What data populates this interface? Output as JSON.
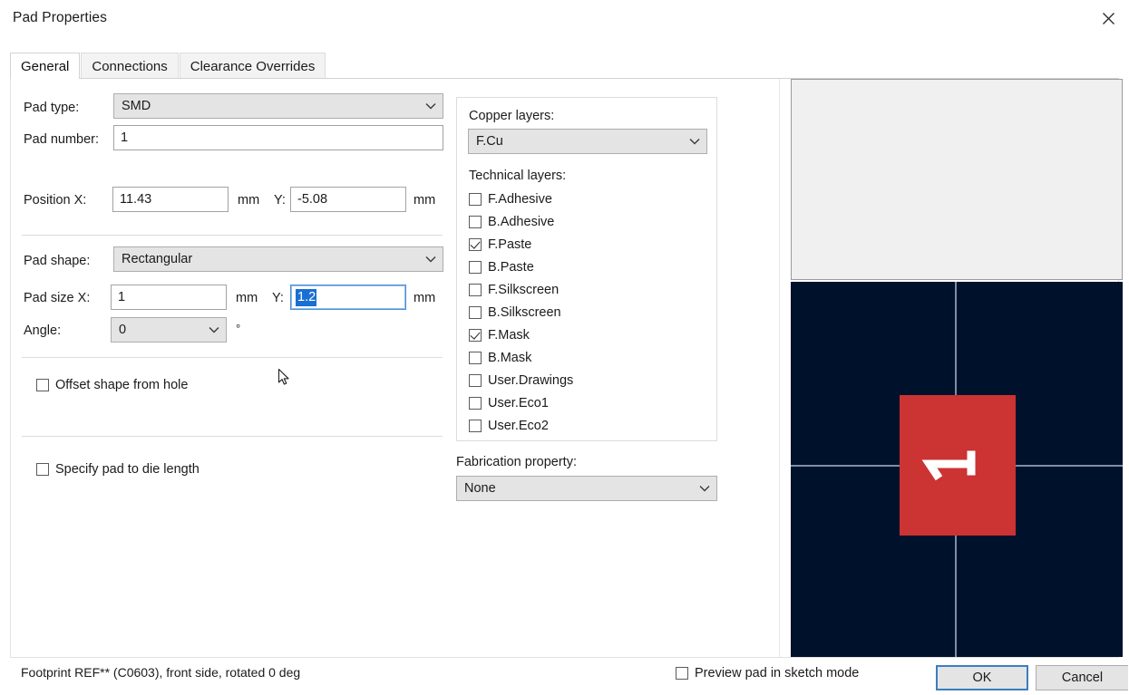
{
  "window": {
    "title": "Pad Properties",
    "close_icon": "close-icon"
  },
  "tabs": [
    {
      "label": "General",
      "active": true
    },
    {
      "label": "Connections",
      "active": false
    },
    {
      "label": "Clearance Overrides",
      "active": false
    }
  ],
  "general": {
    "pad_type": {
      "label": "Pad type:",
      "value": "SMD"
    },
    "pad_number": {
      "label": "Pad number:",
      "value": "1"
    },
    "position": {
      "x_label": "Position X:",
      "x_value": "11.43",
      "x_unit": "mm",
      "y_label": "Y:",
      "y_value": "-5.08",
      "y_unit": "mm"
    },
    "pad_shape": {
      "label": "Pad shape:",
      "value": "Rectangular"
    },
    "pad_size": {
      "x_label": "Pad size X:",
      "x_value": "1",
      "x_unit": "mm",
      "y_label": "Y:",
      "y_value": "1.2",
      "y_unit": "mm",
      "y_selected": true
    },
    "angle": {
      "label": "Angle:",
      "value": "0",
      "unit": "°"
    },
    "offset_shape": {
      "label": "Offset shape from hole",
      "checked": false
    },
    "die_length": {
      "label": "Specify pad to die length",
      "checked": false
    }
  },
  "layers": {
    "copper_label": "Copper layers:",
    "copper_value": "F.Cu",
    "technical_label": "Technical layers:",
    "technical_items": [
      {
        "label": "F.Adhesive",
        "checked": false
      },
      {
        "label": "B.Adhesive",
        "checked": false
      },
      {
        "label": "F.Paste",
        "checked": true
      },
      {
        "label": "B.Paste",
        "checked": false
      },
      {
        "label": "F.Silkscreen",
        "checked": false
      },
      {
        "label": "B.Silkscreen",
        "checked": false
      },
      {
        "label": "F.Mask",
        "checked": true
      },
      {
        "label": "B.Mask",
        "checked": false
      },
      {
        "label": "User.Drawings",
        "checked": false
      },
      {
        "label": "User.Eco1",
        "checked": false
      },
      {
        "label": "User.Eco2",
        "checked": false
      }
    ]
  },
  "fabrication": {
    "label": "Fabrication property:",
    "value": "None"
  },
  "preview": {
    "background_color": "#00112b",
    "pad_color": "#cc3333",
    "crosshair_color": "#93a4bb",
    "pad_number_glyph": "1"
  },
  "footer": {
    "status": "Footprint REF** (C0603), front side, rotated 0 deg",
    "sketch_mode": {
      "label": "Preview pad in sketch mode",
      "checked": false
    },
    "ok_label": "OK",
    "cancel_label": "Cancel"
  }
}
